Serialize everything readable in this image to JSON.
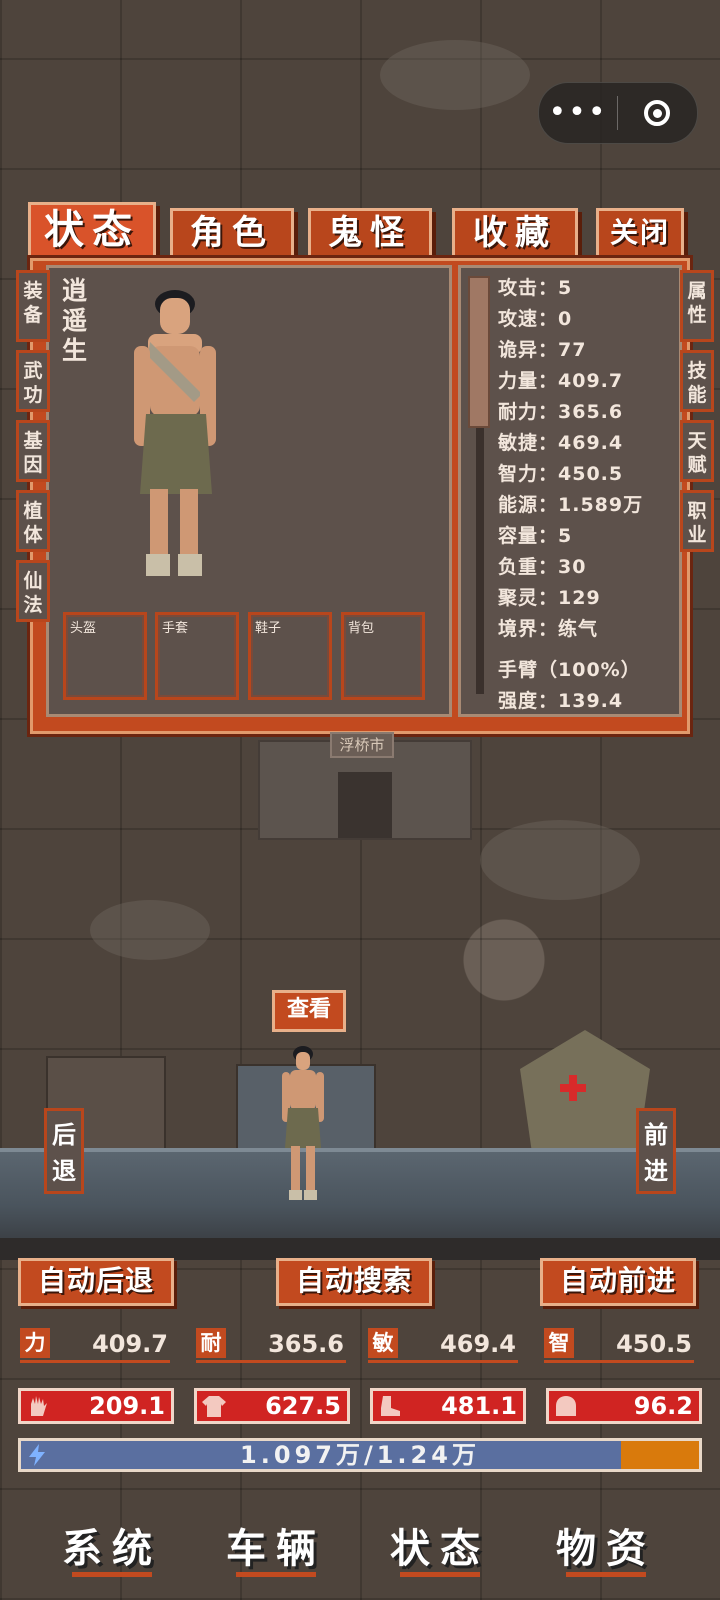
{
  "tabs": [
    {
      "label": "状态",
      "active": true
    },
    {
      "label": "角色",
      "active": false
    },
    {
      "label": "鬼怪",
      "active": false
    },
    {
      "label": "收藏",
      "active": false
    },
    {
      "label": "关闭",
      "active": false
    }
  ],
  "left_side_tabs": [
    "装备",
    "武功",
    "基因",
    "植体",
    "仙法"
  ],
  "right_side_tabs": [
    "属性",
    "技能",
    "天赋",
    "职业"
  ],
  "character": {
    "name": "逍遥生",
    "slots": [
      "头盔",
      "手套",
      "鞋子",
      "背包"
    ]
  },
  "stats": [
    "攻击：5",
    "攻速：0",
    "诡异：77",
    "力量：409.7",
    "耐力：365.6",
    "敏捷：469.4",
    "智力：450.5",
    "能源：1.589万",
    "容量：5",
    "负重：30",
    "聚灵：129",
    "境界：练气",
    "手臂（100%）",
    "强度：139.4"
  ],
  "location_sign": "浮桥市",
  "view_button": "查看",
  "retreat_label": "后退",
  "advance_label": "前进",
  "auto_buttons": {
    "retreat": "自动后退",
    "search": "自动搜索",
    "advance": "自动前进"
  },
  "attributes": [
    {
      "key": "力",
      "value": "409.7"
    },
    {
      "key": "耐",
      "value": "365.6"
    },
    {
      "key": "敏",
      "value": "469.4"
    },
    {
      "key": "智",
      "value": "450.5"
    }
  ],
  "gear_values": [
    {
      "icon": "hand-icon",
      "value": "209.1"
    },
    {
      "icon": "shirt-icon",
      "value": "627.5"
    },
    {
      "icon": "boot-icon",
      "value": "481.1"
    },
    {
      "icon": "helmet-icon",
      "value": "96.2"
    }
  ],
  "energy": {
    "text": "1.097万/1.24万",
    "fraction": 0.885
  },
  "bottom_nav": [
    "系统",
    "车辆",
    "状态",
    "物资"
  ],
  "colors": {
    "accent": "#c24a1f",
    "gear_red": "#d02422",
    "energy_blue": "#5a6fa0",
    "energy_orange": "#d97a0c"
  }
}
